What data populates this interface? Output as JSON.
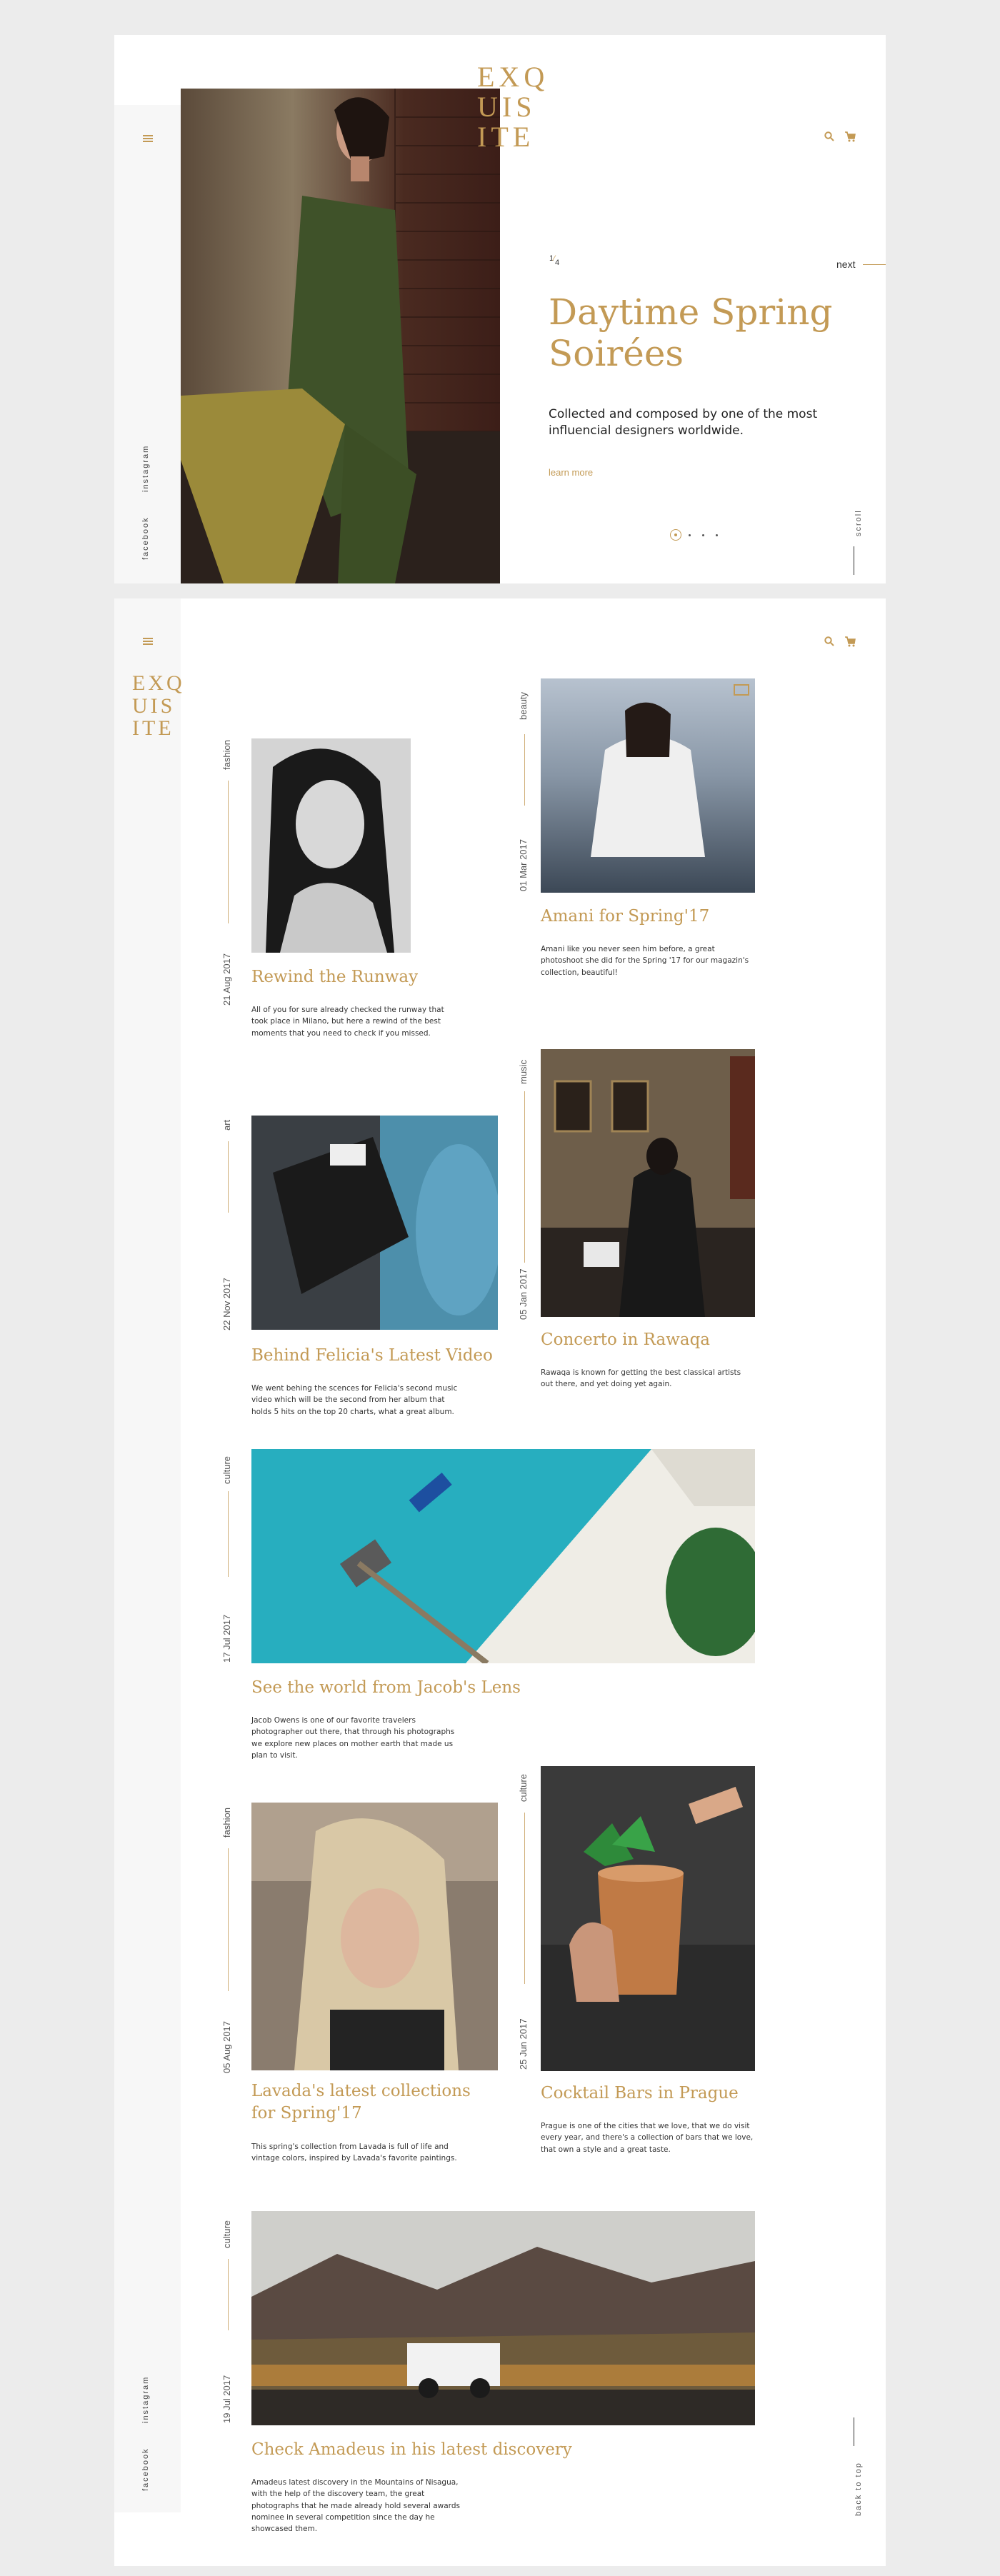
{
  "brand": {
    "logo_lines": [
      "EXQ",
      "UIS",
      "ITE"
    ],
    "accent": "#c39a55"
  },
  "hero": {
    "slide_current": "1",
    "slide_total": "4",
    "next_label": "next",
    "title": "Daytime Spring Soirées",
    "subtitle": "Collected and composed by one of the most influencial designers worldwide.",
    "cta": "learn more",
    "scroll_label": "scroll",
    "dots": 4,
    "social": [
      "facebook",
      "instagram"
    ]
  },
  "blog": {
    "social": [
      "facebook",
      "instagram"
    ],
    "back_to_top": "back to top",
    "posts": [
      {
        "category": "fashion",
        "date": "21 Aug 2017",
        "title": "Rewind the Runway",
        "description": "All of you for sure already checked the runway that took place in Milano, but here a rewind of the best moments that you need to check if you missed."
      },
      {
        "category": "beauty",
        "date": "01 Mar 2017",
        "title": "Amani for Spring'17",
        "description": "Amani like you never seen him before, a great photoshoot she did for the Spring '17 for our magazin's collection, beautiful!"
      },
      {
        "category": "art",
        "date": "22 Nov 2017",
        "title": "Behind Felicia's Latest Video",
        "description": "We went behing the scences for Felicia's second music video which will be the second from her album that holds 5 hits on the top 20 charts, what a great album."
      },
      {
        "category": "music",
        "date": "05 Jan 2017",
        "title": "Concerto in Rawaqa",
        "description": "Rawaqa is known for getting the best classical artists out there, and yet doing yet again."
      },
      {
        "category": "culture",
        "date": "17 Jul 2017",
        "title": "See the world from Jacob's Lens",
        "description": "Jacob Owens is one of our favorite travelers photographer out there, that through his photographs we explore new places on mother earth that made us plan to visit."
      },
      {
        "category": "fashion",
        "date": "05 Aug 2017",
        "title": "Lavada's latest collections for Spring'17",
        "description": "This spring's collection from Lavada is full of life and vintage colors, inspired by Lavada's favorite paintings."
      },
      {
        "category": "culture",
        "date": "25 Jun 2017",
        "title": "Cocktail Bars in Prague",
        "description": "Prague is one of the cities that we love, that we do visit every year, and there's a collection of bars that we love, that own a style and a great taste."
      },
      {
        "category": "culture",
        "date": "19 Jul 2017",
        "title": "Check Amadeus in his latest discovery",
        "description": "Amadeus latest discovery in the Mountains of Nisagua, with the help of the discovery team, the great photographs that he made already hold several awards nominee in several competition since the day he showcased them."
      }
    ]
  }
}
